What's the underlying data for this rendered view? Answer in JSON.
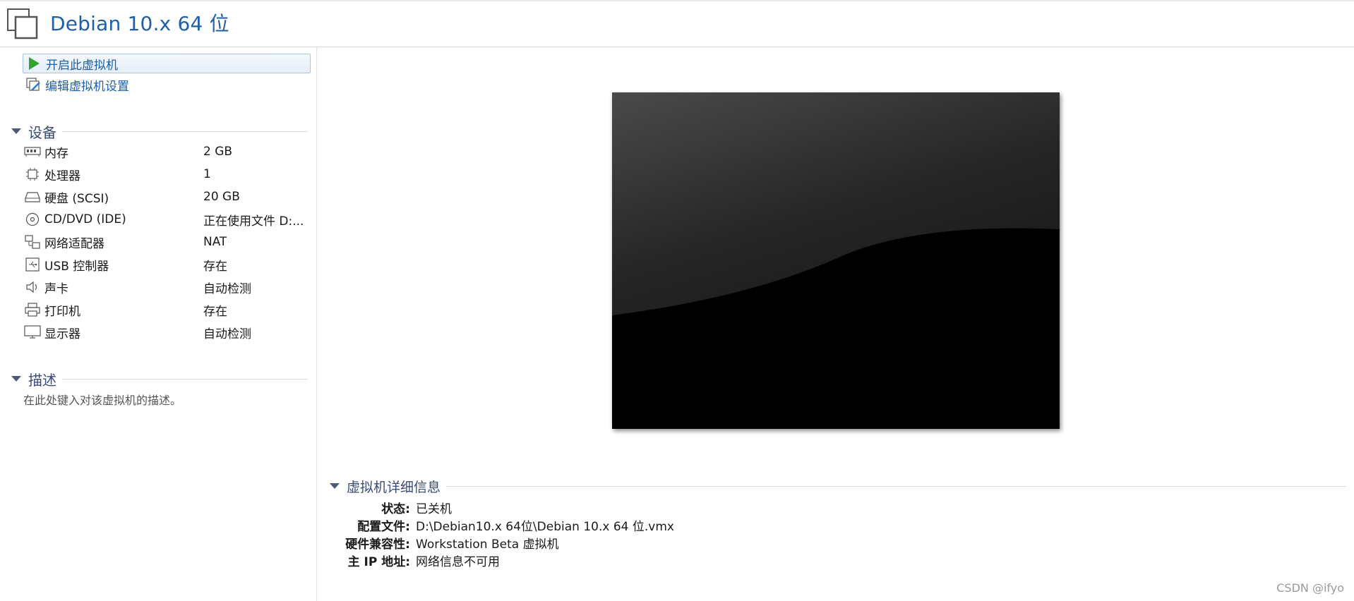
{
  "window": {
    "title": "Debian 10.x 64 位"
  },
  "actions": {
    "start_label": "开启此虚拟机",
    "edit_label": "编辑虚拟机设置"
  },
  "devices": {
    "section_label": "设备",
    "items": [
      {
        "icon": "memory-icon",
        "name": "内存",
        "value": "2 GB"
      },
      {
        "icon": "cpu-icon",
        "name": "处理器",
        "value": "1"
      },
      {
        "icon": "harddisk-icon",
        "name": "硬盘 (SCSI)",
        "value": "20 GB"
      },
      {
        "icon": "cd-dvd-icon",
        "name": "CD/DVD (IDE)",
        "value": "正在使用文件 D:..."
      },
      {
        "icon": "network-adapter-icon",
        "name": "网络适配器",
        "value": "NAT"
      },
      {
        "icon": "usb-icon",
        "name": "USB 控制器",
        "value": "存在"
      },
      {
        "icon": "sound-icon",
        "name": "声卡",
        "value": "自动检测"
      },
      {
        "icon": "printer-icon",
        "name": "打印机",
        "value": "存在"
      },
      {
        "icon": "display-icon",
        "name": "显示器",
        "value": "自动检测"
      }
    ]
  },
  "description": {
    "section_label": "描述",
    "placeholder": "在此处键入对该虚拟机的描述。"
  },
  "details": {
    "section_label": "虚拟机详细信息",
    "rows": [
      {
        "key": "状态:",
        "value": "已关机"
      },
      {
        "key": "配置文件:",
        "value": "D:\\Debian10.x 64位\\Debian 10.x 64 位.vmx"
      },
      {
        "key": "硬件兼容性:",
        "value": "Workstation Beta 虚拟机"
      },
      {
        "key": "主 IP 地址:",
        "value": "网络信息不可用"
      }
    ]
  },
  "watermark": "CSDN @ifyo",
  "colors": {
    "accent": "#1e5fa8",
    "section": "#3a4a7a",
    "play": "#2fa52f"
  }
}
